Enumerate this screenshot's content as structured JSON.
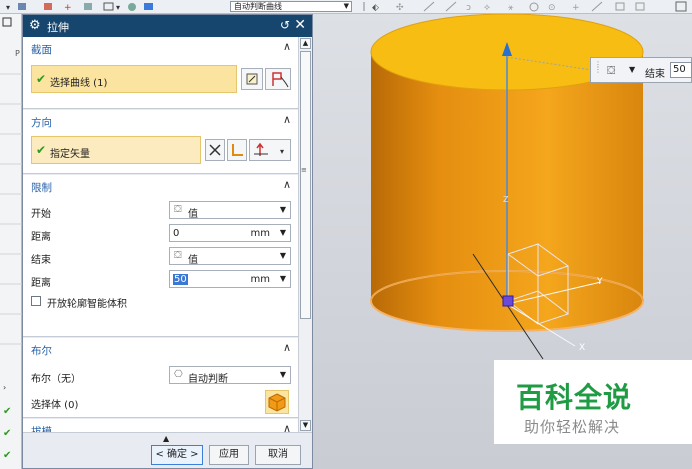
{
  "toolbar": {
    "filter_value": "自动判断曲线"
  },
  "dialog": {
    "title": "拉伸",
    "sections": {
      "section_curve": {
        "title": "截面",
        "select_label": "选择曲线 (1)"
      },
      "direction": {
        "title": "方向",
        "vector_label": "指定矢量"
      },
      "limits": {
        "title": "限制",
        "start_label": "开始",
        "start_value": "值",
        "distance1_label": "距离",
        "distance1_value": "0",
        "distance1_unit": "mm",
        "end_label": "结束",
        "end_value": "值",
        "distance2_label": "距离",
        "distance2_value": "50",
        "distance2_unit": "mm",
        "open_profile_label": "开放轮廓智能体积"
      },
      "boolean": {
        "title": "布尔",
        "bool_label": "布尔（无）",
        "bool_value": "自动判断",
        "select_body_label": "选择体 (0)"
      },
      "draft": {
        "title": "拔模"
      }
    },
    "footer": {
      "ok_label": "< 确定 >",
      "apply_label": "应用",
      "cancel_label": "取消"
    }
  },
  "viewport": {
    "end_popup": {
      "label": "结束",
      "value": "50"
    },
    "axis_labels": {
      "x": "X",
      "y": "Y",
      "z": "Z"
    }
  },
  "watermark": {
    "title": "百科全说",
    "subtitle": "助你轻松解决"
  },
  "colors": {
    "title_bar": "#16456d",
    "selection_fill": "#fbe3a0",
    "cylinder": "#f2a316",
    "cylinder_top": "#f7bd12",
    "accent": "#2a62a8"
  }
}
